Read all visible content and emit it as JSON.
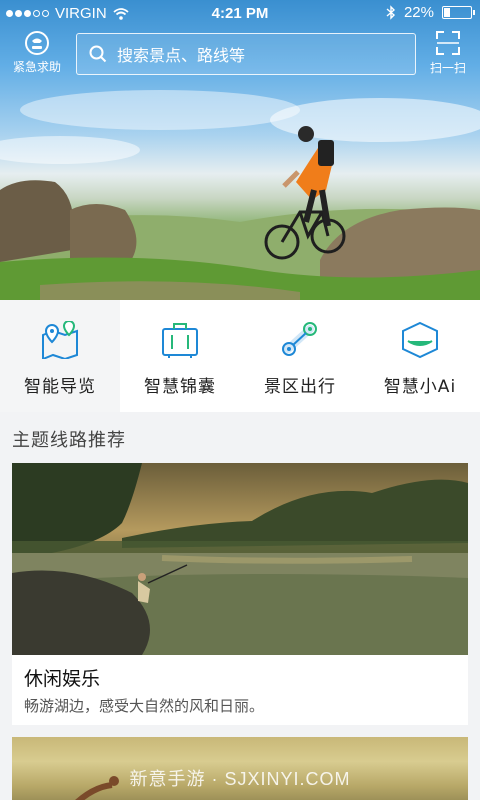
{
  "status_bar": {
    "carrier": "VIRGIN",
    "time": "4:21 PM",
    "battery": "22%",
    "battery_level": 0.22
  },
  "header": {
    "sos_label": "紧急求助",
    "search_placeholder": "搜索景点、路线等",
    "scan_label": "扫一扫"
  },
  "quick_nav": [
    {
      "label": "智能导览",
      "icon": "map-pin-icon"
    },
    {
      "label": "智慧锦囊",
      "icon": "suitcase-icon"
    },
    {
      "label": "景区出行",
      "icon": "route-icon"
    },
    {
      "label": "智慧小Ai",
      "icon": "ai-box-icon"
    }
  ],
  "section": {
    "title": "主题线路推荐"
  },
  "cards": [
    {
      "title": "休闲娱乐",
      "description": "畅游湖边，感受大自然的风和日丽。"
    }
  ],
  "watermark": "新意手游 · SJXINYI.COM",
  "colors": {
    "accent": "#1e88d6",
    "accent_green": "#26b87a"
  }
}
